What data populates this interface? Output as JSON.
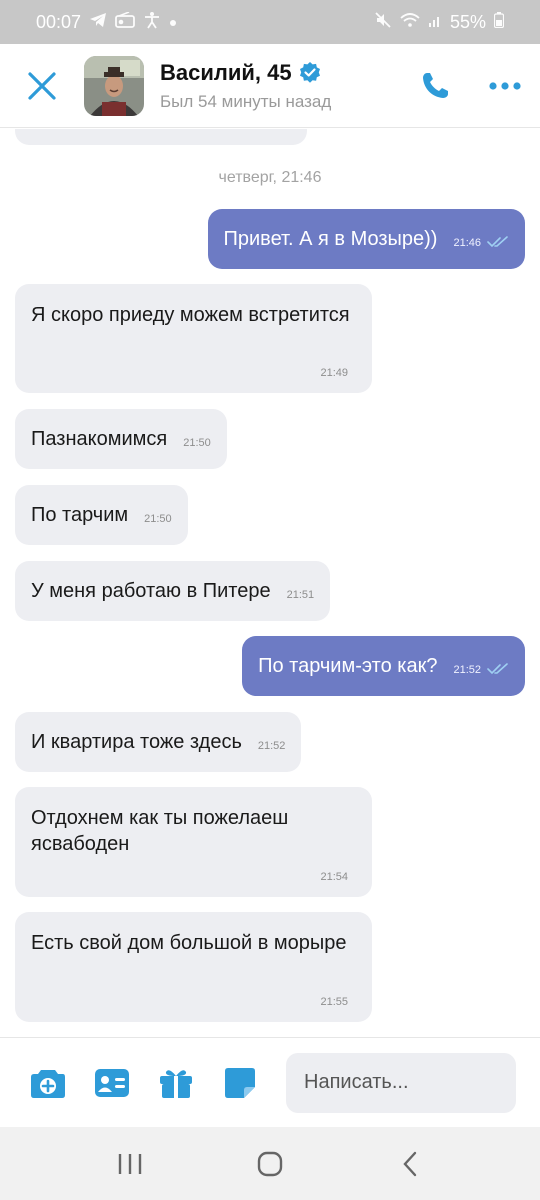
{
  "status_bar": {
    "time": "00:07",
    "battery": "55%"
  },
  "header": {
    "name": "Василий, 45",
    "status": "Был 54 минуты назад",
    "icons": {
      "close": "close-icon",
      "verified": "verified-badge-icon",
      "call": "phone-icon",
      "more": "more-dots-icon"
    }
  },
  "chat": {
    "date_separator": "четверг, 21:46",
    "messages": [
      {
        "direction": "out",
        "text": "Привет. А я в Мозыре))",
        "time": "21:46",
        "read": true
      },
      {
        "direction": "in",
        "text": "Я скоро приеду можем встретится",
        "time": "21:49"
      },
      {
        "direction": "in",
        "text": "Пазнакомимся",
        "time": "21:50"
      },
      {
        "direction": "in",
        "text": "По тарчим",
        "time": "21:50"
      },
      {
        "direction": "in",
        "text": "У меня работаю в Питере",
        "time": "21:51"
      },
      {
        "direction": "out",
        "text": "По тарчим-это как?",
        "time": "21:52",
        "read": true
      },
      {
        "direction": "in",
        "text": "И квартира тоже здесь",
        "time": "21:52"
      },
      {
        "direction": "in",
        "text": "Отдохнем как ты пожелаеш ясвабоден",
        "time": "21:54"
      },
      {
        "direction": "in",
        "text": "Есть свой дом большой в морыре",
        "time": "21:55"
      }
    ]
  },
  "composer": {
    "placeholder": "Написать...",
    "icons": [
      "camera-plus-icon",
      "contact-card-icon",
      "gift-icon",
      "sticker-icon"
    ]
  },
  "colors": {
    "accent": "#2e9bd8",
    "outgoing_bubble": "#6d7bc4",
    "incoming_bubble": "#edeef2"
  }
}
